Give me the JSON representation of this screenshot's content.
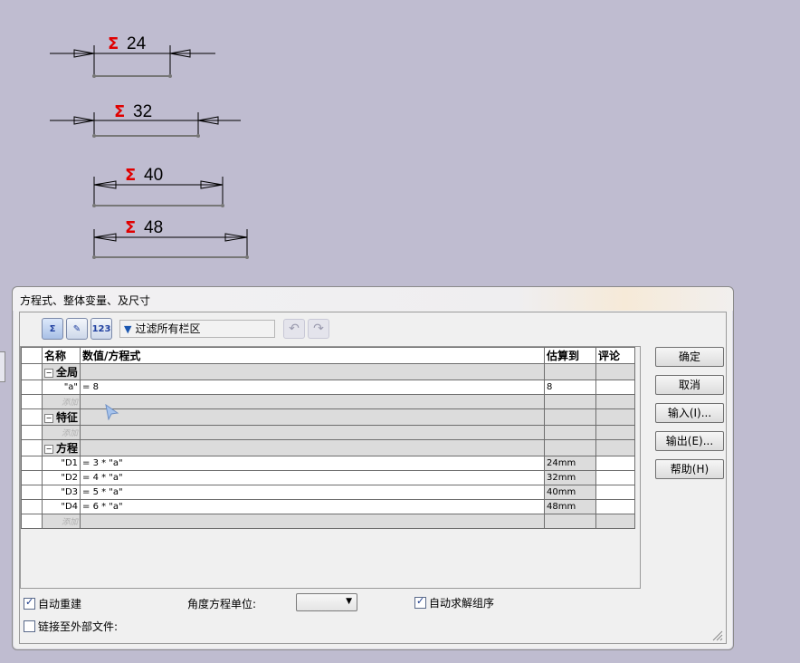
{
  "dimensions": [
    {
      "value": "24"
    },
    {
      "value": "32"
    },
    {
      "value": "40"
    },
    {
      "value": "48"
    }
  ],
  "dialog": {
    "title": "方程式、整体变量、及尺寸",
    "filter_text": "过滤所有栏区",
    "toolbar_icons": [
      "equation-view-icon",
      "sketch-equation-view-icon",
      "ordered-view-icon"
    ],
    "columns": [
      "名称",
      "数值/方程式",
      "估算到",
      "评论"
    ],
    "rows": [
      {
        "type": "group",
        "name": "全局"
      },
      {
        "type": "item",
        "name": "\"a\"",
        "value": "= 8",
        "eval": "8",
        "comment": ""
      },
      {
        "type": "add",
        "name": "添加"
      },
      {
        "type": "group",
        "name": "特征"
      },
      {
        "type": "add",
        "name": "添加"
      },
      {
        "type": "group",
        "name": "方程"
      },
      {
        "type": "item",
        "name": "\"D1",
        "value": "= 3 * \"a\"",
        "eval": "24mm",
        "comment": ""
      },
      {
        "type": "item",
        "name": "\"D2",
        "value": "= 4 * \"a\"",
        "eval": "32mm",
        "comment": ""
      },
      {
        "type": "item",
        "name": "\"D3",
        "value": "= 5 * \"a\"",
        "eval": "40mm",
        "comment": ""
      },
      {
        "type": "item",
        "name": "\"D4",
        "value": "= 6 * \"a\"",
        "eval": "48mm",
        "comment": ""
      },
      {
        "type": "add",
        "name": "添加"
      }
    ],
    "buttons": {
      "ok": "确定",
      "cancel": "取消",
      "import": "输入(I)...",
      "export": "输出(E)...",
      "help": "帮助(H)"
    },
    "options": {
      "auto_rebuild": {
        "label": "自动重建",
        "checked": true
      },
      "angle_unit_label": "角度方程单位:",
      "angle_unit_value": "",
      "auto_solve_order": {
        "label": "自动求解组序",
        "checked": true
      },
      "link_external": {
        "label": "链接至外部文件:",
        "checked": false
      }
    }
  }
}
